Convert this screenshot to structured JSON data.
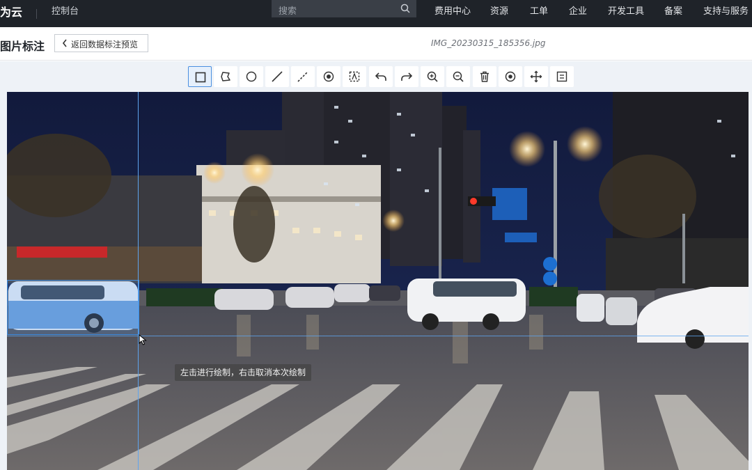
{
  "topnav": {
    "brand": "为云",
    "console": "控制台",
    "search_placeholder": "搜索",
    "items": [
      "费用中心",
      "资源",
      "工单",
      "企业",
      "开发工具",
      "备案",
      "支持与服务"
    ]
  },
  "header": {
    "title": "图片标注",
    "back_label": "返回数据标注预览",
    "filename": "IMG_20230315_185356.jpg"
  },
  "toolbar": {
    "tools": [
      {
        "icon": "rectangle-icon",
        "active": true
      },
      {
        "icon": "polygon-icon"
      },
      {
        "icon": "circle-icon"
      },
      {
        "icon": "line-icon"
      },
      {
        "icon": "dashed-line-icon"
      },
      {
        "icon": "point-icon"
      },
      {
        "icon": "polygon-select-icon"
      },
      {
        "icon": "undo-icon"
      },
      {
        "icon": "redo-icon"
      },
      {
        "icon": "zoom-in-icon"
      },
      {
        "icon": "zoom-out-icon"
      },
      {
        "icon": "delete-icon"
      },
      {
        "icon": "visibility-icon"
      },
      {
        "icon": "move-icon"
      },
      {
        "icon": "fit-icon"
      }
    ]
  },
  "canvas": {
    "tooltip": "左击进行绘制，右击取消本次绘制",
    "accent": "#3d8be0"
  }
}
